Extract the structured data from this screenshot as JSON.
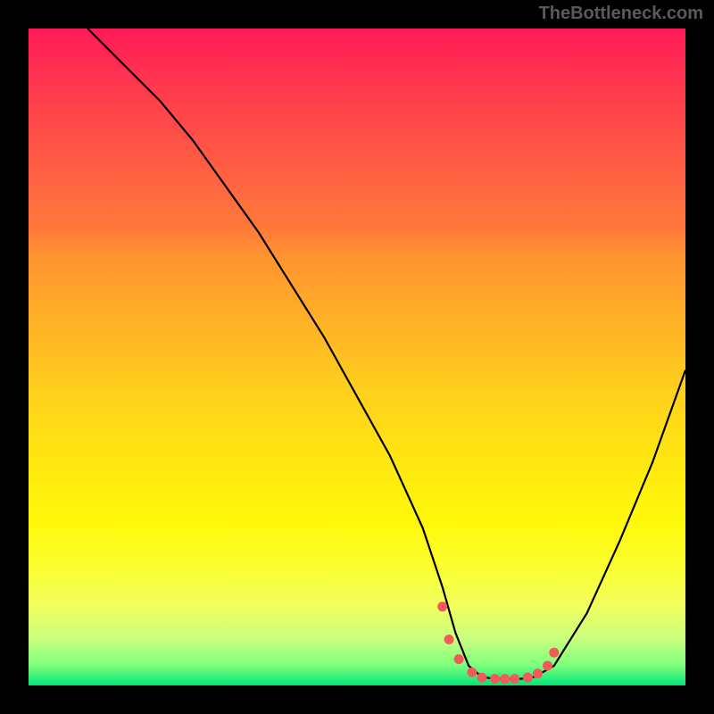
{
  "watermark": "TheBottleneck.com",
  "chart_data": {
    "type": "line",
    "title": "",
    "xlabel": "",
    "ylabel": "",
    "xlim": [
      0,
      100
    ],
    "ylim": [
      0,
      100
    ],
    "grid": false,
    "legend": false,
    "background_gradient": {
      "top": "#ff1a56",
      "mid": "#ffe512",
      "bottom": "#00e676"
    },
    "series": [
      {
        "name": "bottleneck-curve",
        "color": "#000000",
        "x": [
          9,
          12,
          15,
          20,
          25,
          30,
          35,
          40,
          45,
          50,
          55,
          60,
          63,
          65,
          67,
          69,
          71,
          73,
          75,
          77,
          80,
          85,
          90,
          95,
          100
        ],
        "y": [
          100,
          97,
          94,
          89,
          83,
          76,
          69,
          61,
          53,
          44,
          35,
          24,
          15,
          8,
          3,
          1.3,
          1.0,
          1.0,
          1.0,
          1.3,
          3,
          11,
          22,
          34,
          48
        ]
      }
    ],
    "markers": {
      "name": "optimal-range",
      "color": "#f55a5a",
      "x": [
        63.0,
        64.0,
        65.5,
        67.5,
        69.0,
        71.0,
        72.5,
        74.0,
        76.0,
        77.5,
        79.0,
        80.0
      ],
      "y": [
        12.0,
        7.0,
        4.0,
        2.0,
        1.2,
        1.0,
        1.0,
        1.0,
        1.2,
        1.8,
        3.0,
        5.0
      ]
    }
  }
}
